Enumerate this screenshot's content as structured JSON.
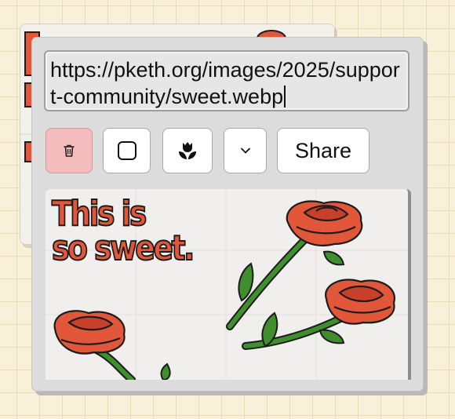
{
  "url_field": {
    "value": "https://pketh.org/images/2025/support-community/sweet.webp"
  },
  "toolbar": {
    "delete_icon": "trash-icon",
    "square_icon": "square-icon",
    "flower_icon": "tulip-icon",
    "chevron_icon": "chevron-down-icon",
    "share_label": "Share"
  },
  "image": {
    "line1": "This is",
    "line2": "so sweet."
  },
  "colors": {
    "background": "#f8f0d8",
    "card": "#dcdcdc",
    "delete_button": "#f4bcbc",
    "rose": "#e2563a",
    "stem": "#3f8f2f"
  }
}
